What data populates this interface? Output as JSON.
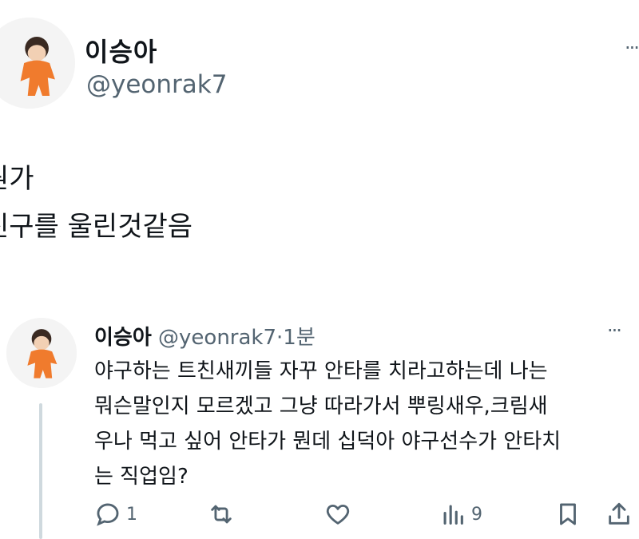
{
  "main_tweet": {
    "author_name": "이승아",
    "author_handle": "@yeonrak7",
    "more_label": "···",
    "lines": [
      "뭔가",
      "친구를 울린것같음"
    ]
  },
  "quoted_reply": {
    "author_name": "이승아",
    "author_handle": "@yeonrak7",
    "separator": "·",
    "time": "1분",
    "more_label": "···",
    "text_lines": [
      "야구하는 트친새끼들 자꾸 안타를 치라고하는데 나는",
      "뭐슨말인지 모르겠고 그냥 따라가서 뿌링새우,크림새",
      "우나 먹고 싶어 안타가 뭔데 십덕아 야구선수가 안타치",
      "는 직업임?"
    ],
    "actions": {
      "reply_count": "1",
      "retweet_count": "",
      "like_count": "",
      "views_count": "9"
    }
  },
  "icons": {
    "reply": "reply-icon",
    "retweet": "retweet-icon",
    "like": "heart-icon",
    "views": "views-icon",
    "bookmark": "bookmark-icon",
    "share": "share-icon"
  },
  "colors": {
    "text": "#0f1419",
    "muted": "#536471",
    "avatar_figure": "#f07b2d"
  }
}
